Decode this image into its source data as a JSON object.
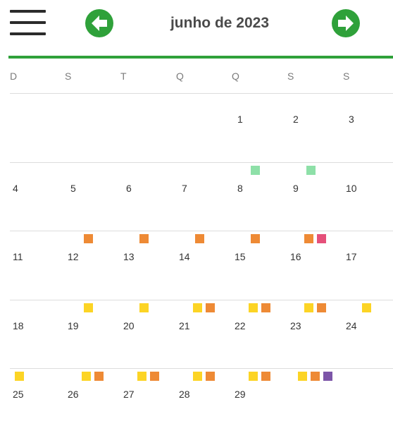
{
  "header": {
    "month_title": "junho de 2023",
    "menu_icon": "menu-icon",
    "prev_icon": "arrow-left-icon",
    "next_icon": "arrow-right-icon",
    "accent_color": "#2fa13a"
  },
  "weekdays": [
    "D",
    "S",
    "T",
    "Q",
    "Q",
    "S",
    "S"
  ],
  "marker_colors": {
    "green": "#8ee0a8",
    "orange": "#ee8a35",
    "pink": "#e5507a",
    "yellow": "#fcd425",
    "purple": "#7c55a8"
  },
  "weeks": [
    [
      {
        "day": "",
        "markers": []
      },
      {
        "day": "",
        "markers": []
      },
      {
        "day": "",
        "markers": []
      },
      {
        "day": "",
        "markers": []
      },
      {
        "day": "1",
        "markers": []
      },
      {
        "day": "2",
        "markers": []
      },
      {
        "day": "3",
        "markers": []
      }
    ],
    [
      {
        "day": "4",
        "markers": []
      },
      {
        "day": "5",
        "markers": []
      },
      {
        "day": "6",
        "markers": []
      },
      {
        "day": "7",
        "markers": []
      },
      {
        "day": "8",
        "markers": [
          "green"
        ]
      },
      {
        "day": "9",
        "markers": [
          "green"
        ]
      },
      {
        "day": "10",
        "markers": []
      }
    ],
    [
      {
        "day": "11",
        "markers": []
      },
      {
        "day": "12",
        "markers": [
          "orange"
        ]
      },
      {
        "day": "13",
        "markers": [
          "orange"
        ]
      },
      {
        "day": "14",
        "markers": [
          "orange"
        ]
      },
      {
        "day": "15",
        "markers": [
          "orange"
        ]
      },
      {
        "day": "16",
        "markers": [
          "orange",
          "pink"
        ]
      },
      {
        "day": "17",
        "markers": []
      }
    ],
    [
      {
        "day": "18",
        "markers": []
      },
      {
        "day": "19",
        "markers": [
          "yellow"
        ]
      },
      {
        "day": "20",
        "markers": [
          "yellow"
        ]
      },
      {
        "day": "21",
        "markers": [
          "yellow",
          "orange"
        ]
      },
      {
        "day": "22",
        "markers": [
          "yellow",
          "orange"
        ]
      },
      {
        "day": "23",
        "markers": [
          "yellow",
          "orange"
        ]
      },
      {
        "day": "24",
        "markers": [
          "yellow"
        ]
      }
    ],
    [
      {
        "day": "25",
        "markers": [
          "yellow"
        ]
      },
      {
        "day": "26",
        "markers": [
          "yellow",
          "orange"
        ]
      },
      {
        "day": "27",
        "markers": [
          "yellow",
          "orange"
        ]
      },
      {
        "day": "28",
        "markers": [
          "yellow",
          "orange"
        ]
      },
      {
        "day": "29",
        "markers": [
          "yellow",
          "orange"
        ]
      },
      {
        "day": "",
        "markers": [
          "yellow",
          "orange",
          "purple"
        ]
      },
      {
        "day": "",
        "markers": []
      }
    ]
  ]
}
